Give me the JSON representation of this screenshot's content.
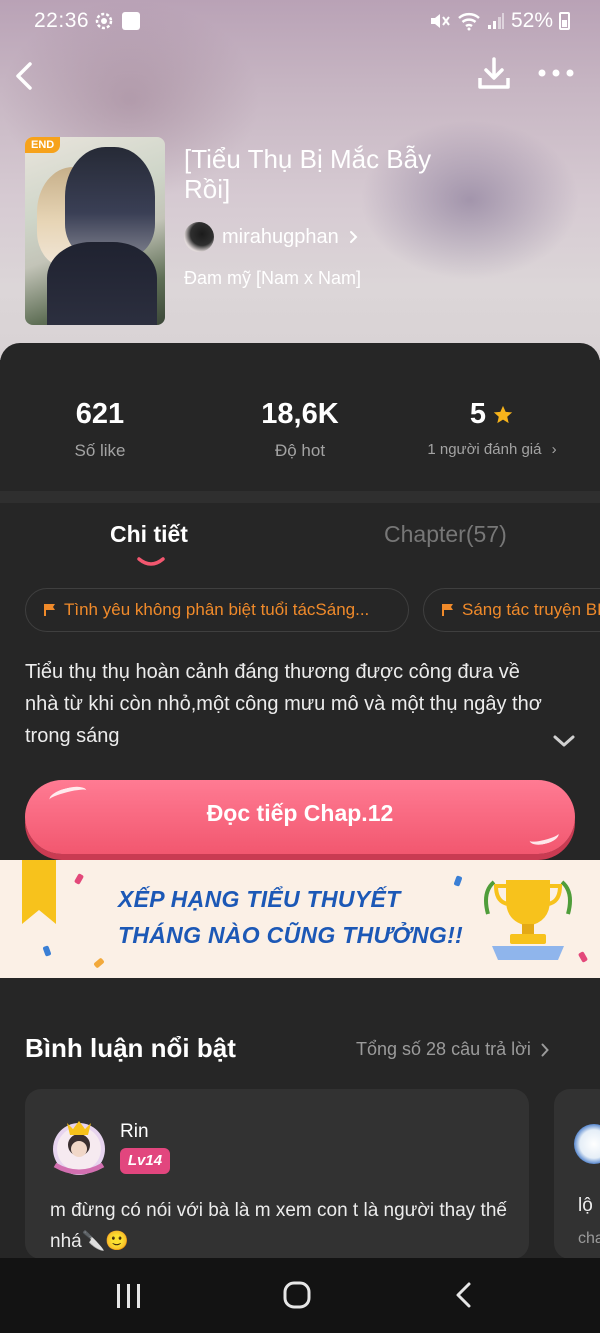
{
  "status_bar": {
    "time": "22:36",
    "battery": "52%"
  },
  "story": {
    "title": "[Tiểu Thụ Bị Mắc Bẫy Rồi]",
    "cover_badge": "END",
    "author": "mirahugphan",
    "genre": "Đam mỹ [Nam x Nam]"
  },
  "stats": {
    "likes": {
      "value": "621",
      "label": "Số like"
    },
    "hot": {
      "value": "18,6K",
      "label": "Độ hot"
    },
    "rating": {
      "value": "5",
      "label": "1 người đánh giá"
    }
  },
  "tabs": {
    "detail": "Chi tiết",
    "chapters": "Chapter(57)"
  },
  "tags": [
    "Tình yêu không phân biệt tuổi tácSáng...",
    "Sáng tác truyện BL"
  ],
  "description": "Tiểu thụ thụ hoàn cảnh đáng thương được công đưa về nhà từ khi còn nhỏ,một công mưu mô và một thụ ngây thơ trong sáng",
  "read_button": "Đọc tiếp Chap.12",
  "banner": {
    "line1": "XẾP HẠNG TIỂU THUYẾT",
    "line2": "THÁNG NÀO CŨNG THƯỞNG!!"
  },
  "comments": {
    "heading": "Bình luận nổi bật",
    "total": "Tổng số 28 câu trả lời",
    "items": [
      {
        "user": "Rin",
        "level": "Lv14",
        "text": "m đừng có nói với bà là m xem con t là người thay thế nhá🔪🙂"
      },
      {
        "text": "lộ",
        "sub": "cha"
      }
    ]
  },
  "colors": {
    "accent": "#f2576f",
    "tag_text": "#f08a2a",
    "panel_bg": "#262626",
    "star": "#f6b31b"
  }
}
